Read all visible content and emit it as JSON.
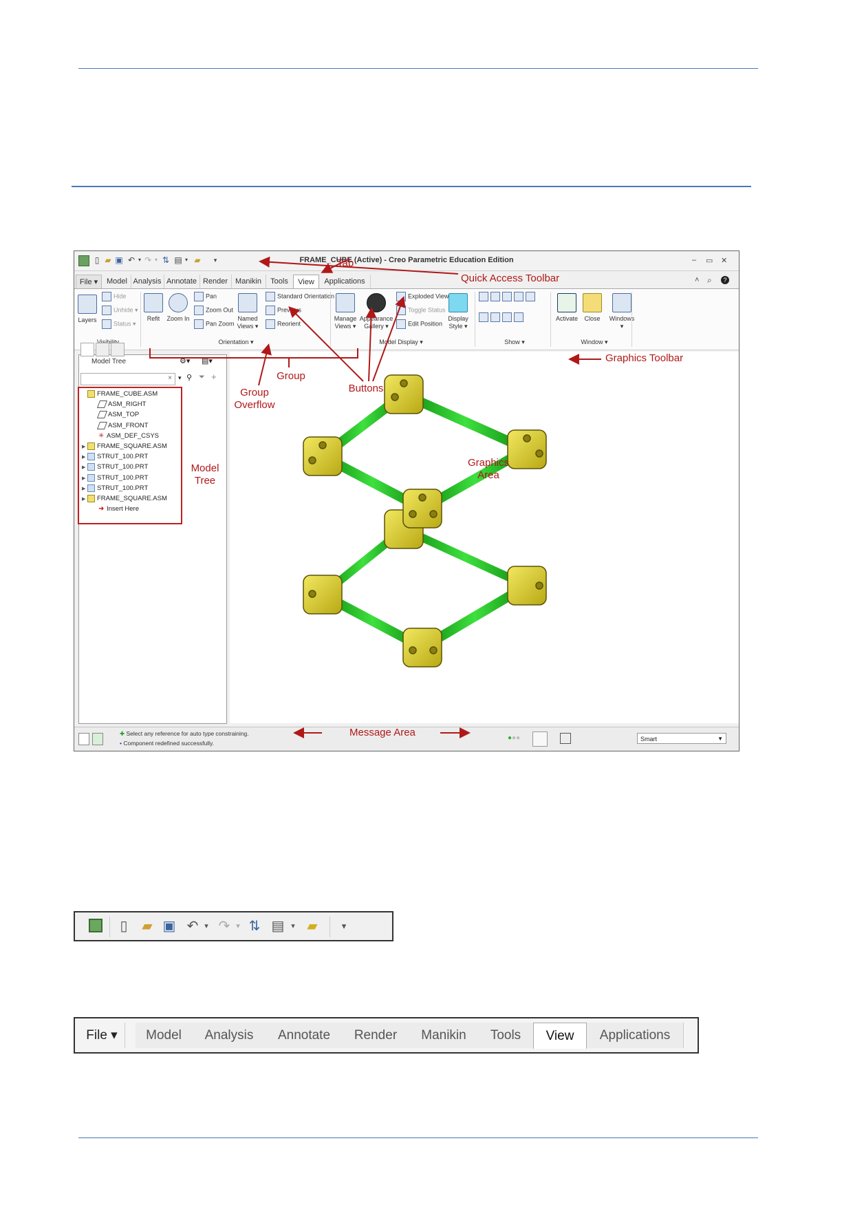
{
  "colors": {
    "rule": "#4a78b8",
    "annotation": "#b01818",
    "frame_node": "#d8c81e",
    "strut": "#1fb81f"
  },
  "window": {
    "title": "FRAME_CUBE (Active) - Creo Parametric Education Edition",
    "tabs": [
      "File ▾",
      "Model",
      "Analysis",
      "Annotate",
      "Render",
      "Manikin",
      "Tools",
      "View",
      "Applications"
    ],
    "active_tab": "View",
    "ribbon": {
      "layers": "Layers",
      "hide": "Hide",
      "unhide": "Unhide",
      "status": "Status",
      "refit": "Refit",
      "zoom_in": "Zoom In",
      "pan": "Pan",
      "zoom_out": "Zoom Out",
      "pan_zoom": "Pan Zoom",
      "named_views_1": "Named",
      "named_views_2": "Views ▾",
      "standard_orientation": "Standard Orientation",
      "previous": "Previous",
      "reorient": "Reorient",
      "manage_views_1": "Manage",
      "manage_views_2": "Views ▾",
      "appearance_1": "Appearance",
      "appearance_2": "Gallery ▾",
      "exploded_view": "Exploded View",
      "toggle_status": "Toggle Status",
      "edit_position": "Edit Position",
      "display_style_1": "Display",
      "display_style_2": "Style ▾",
      "activate": "Activate",
      "close": "Close",
      "windows_1": "Windows",
      "windows_2": "▾",
      "groups": {
        "visibility": "Visibility",
        "orientation": "Orientation ▾",
        "model_display": "Model Display ▾",
        "show": "Show ▾",
        "window": "Window ▾"
      }
    },
    "model_tree": {
      "title": "Model Tree",
      "items": [
        {
          "label": "FRAME_CUBE.ASM",
          "kind": "asm",
          "expand": ""
        },
        {
          "label": "ASM_RIGHT",
          "kind": "plane",
          "expand": ""
        },
        {
          "label": "ASM_TOP",
          "kind": "plane",
          "expand": ""
        },
        {
          "label": "ASM_FRONT",
          "kind": "plane",
          "expand": ""
        },
        {
          "label": "ASM_DEF_CSYS",
          "kind": "csys",
          "expand": ""
        },
        {
          "label": "FRAME_SQUARE.ASM",
          "kind": "asm",
          "expand": "▶"
        },
        {
          "label": "STRUT_100.PRT",
          "kind": "prt",
          "expand": "▶"
        },
        {
          "label": "STRUT_100.PRT",
          "kind": "prt",
          "expand": "▶"
        },
        {
          "label": "STRUT_100.PRT",
          "kind": "prt",
          "expand": "▶"
        },
        {
          "label": "STRUT_100.PRT",
          "kind": "prt",
          "expand": "▶"
        },
        {
          "label": "FRAME_SQUARE.ASM",
          "kind": "asm",
          "expand": "▶"
        },
        {
          "label": "Insert Here",
          "kind": "ins",
          "expand": ""
        }
      ]
    },
    "status": {
      "line1": "Select any reference for auto type constraining.",
      "line2": "Component redefined successfully.",
      "filter": "Smart"
    }
  },
  "annotations": {
    "tab": "Tab",
    "quick_access_toolbar": "Quick Access Toolbar",
    "graphics_toolbar": "Graphics Toolbar",
    "group": "Group",
    "group_overflow_1": "Group",
    "group_overflow_2": "Overflow",
    "buttons": "Buttons",
    "model_tree_1": "Model",
    "model_tree_2": "Tree",
    "graphics_area_1": "Graphics",
    "graphics_area_2": "Area",
    "message_area": "Message Area"
  },
  "quick_access_large": {
    "icons": [
      "model-tree-icon",
      "new-icon",
      "open-icon",
      "save-icon",
      "undo-icon",
      "dropdown-icon",
      "redo-icon",
      "dropdown-icon",
      "regenerate-icon",
      "windows-icon",
      "dropdown-icon",
      "close-folder-icon",
      "customize-icon"
    ]
  },
  "tabs_large": {
    "items": [
      "File ▾",
      "Model",
      "Analysis",
      "Annotate",
      "Render",
      "Manikin",
      "Tools",
      "View",
      "Applications"
    ],
    "active": "View"
  }
}
